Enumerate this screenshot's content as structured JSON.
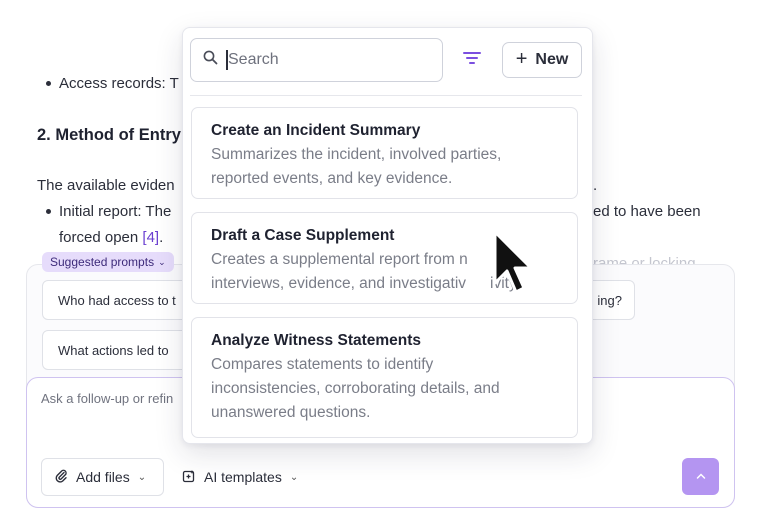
{
  "document": {
    "bullet_access": "Access records: T",
    "heading_method": "2. Method of Entry",
    "para_available": "The available eviden",
    "para_available_tail": ".",
    "bullet_initial": "Initial report: The",
    "bullet_initial_tail": "ed to have been",
    "forced_open": "forced open ",
    "citation": "[4]",
    "citation_tail": ".",
    "right_fragment": "rame or locking"
  },
  "suggested": {
    "badge_label": "Suggested prompts",
    "prompts": [
      {
        "label": "Who had access to t"
      },
      {
        "label": "What actions led to"
      }
    ],
    "right_chip_tail": "ing?"
  },
  "composer": {
    "placeholder": "Ask a follow-up or refin",
    "add_files_label": "Add files",
    "ai_templates_label": "AI templates"
  },
  "templates_popover": {
    "search_placeholder": "Search",
    "new_label": "New",
    "templates": [
      {
        "title": "Create an Incident Summary",
        "description_lines": [
          "Summarizes the incident, involved parties,",
          "reported events, and key evidence."
        ]
      },
      {
        "title": "Draft a Case Supplement",
        "description_lines": [
          "Creates a supplemental report from n",
          "interviews, evidence, and investigativ",
          "ivity"
        ]
      },
      {
        "title": "Analyze Witness Statements",
        "description_lines": [
          "Compares statements to identify",
          "inconsistencies, corroborating details, and",
          "unanswered questions."
        ]
      }
    ]
  },
  "icons": {
    "search": "search-icon",
    "filter": "filter-icon",
    "plus": "plus-icon",
    "paperclip": "paperclip-icon",
    "template": "template-icon",
    "send": "arrow-up-icon",
    "cursor": "mouse-pointer-icon"
  },
  "colors": {
    "accent": "#7b4fe0",
    "send_button": "#b495f1",
    "badge_bg": "#e6dcfb",
    "citation": "#6a3fd0"
  }
}
